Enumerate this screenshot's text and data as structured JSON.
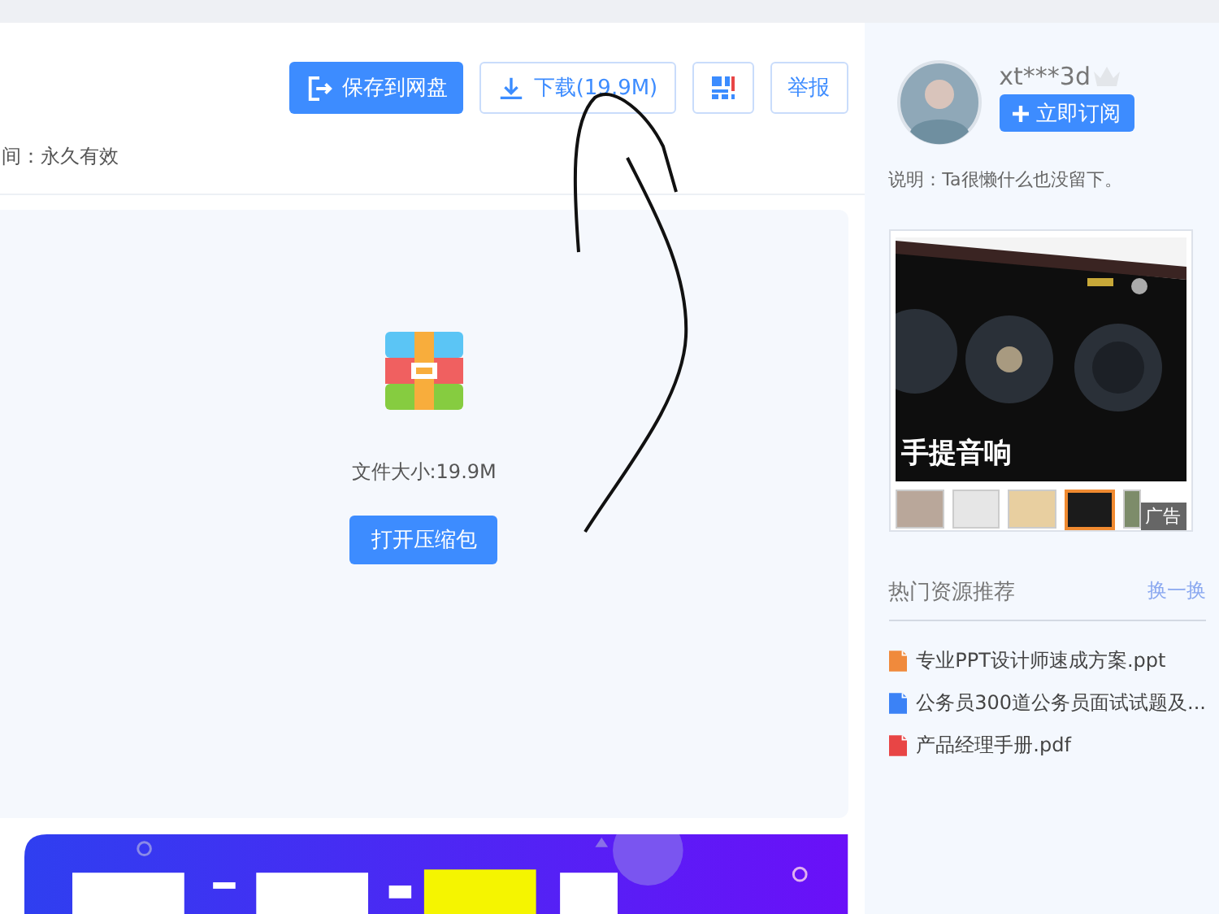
{
  "toolbar": {
    "buttons": [
      {
        "kind": "save",
        "label": "保存到网盘"
      },
      {
        "kind": "download",
        "label": "下载(19.9M)"
      },
      {
        "kind": "qr"
      },
      {
        "kind": "report",
        "label": "举报"
      }
    ]
  },
  "validity": "间：永久有效",
  "preview": {
    "file_size": "文件大小:19.9M",
    "open_button": "打开压缩包"
  },
  "sidebar": {
    "user": {
      "name": "xt***3d",
      "subscribe": "立即订阅",
      "description": "说明：Ta很懒什么也没留下。"
    },
    "ad": {
      "caption": "手提音响",
      "label": "广告",
      "thumbnails": [
        {
          "selected": false
        },
        {
          "selected": false
        },
        {
          "selected": false
        },
        {
          "selected": true
        },
        {
          "selected": false
        }
      ]
    },
    "recommend": {
      "title": "热门资源推荐",
      "refresh": "换一换",
      "items": [
        {
          "kind": "ppt",
          "name": "专业PPT设计师速成方案.ppt"
        },
        {
          "kind": "word",
          "name": "公务员300道公务员面试试题及..."
        },
        {
          "kind": "pdf",
          "name": "产品经理手册.pdf"
        }
      ]
    }
  }
}
